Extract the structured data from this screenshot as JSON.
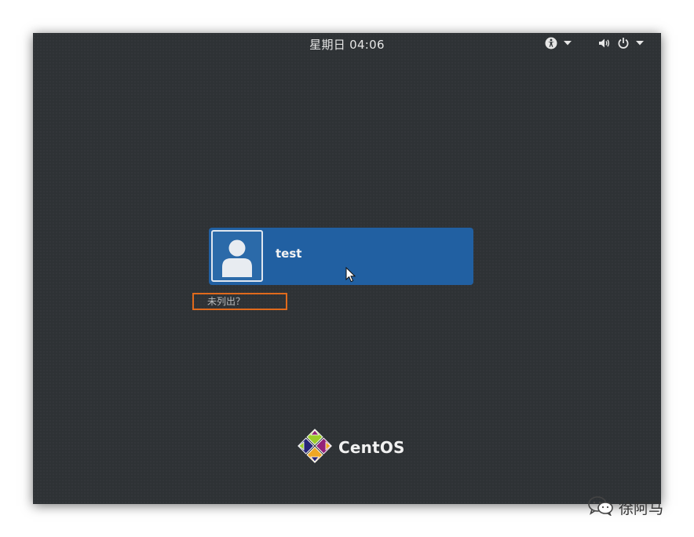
{
  "topbar": {
    "clock": "星期日 04:06",
    "icons": [
      "accessibility-icon",
      "chevron-down-icon",
      "volume-icon",
      "power-icon",
      "chevron-down-icon"
    ]
  },
  "users": [
    {
      "name": "test",
      "avatar_icon": "user-avatar-icon"
    }
  ],
  "not_listed_label": "未列出？",
  "brand": {
    "name": "CentOS",
    "logo_icon": "centos-logo-icon"
  },
  "watermark": {
    "text": "徐阿马",
    "icon": "wechat-icon"
  },
  "colors": {
    "background": "#2e3235",
    "user_card": "#2160a2",
    "highlight_border": "#e06a1c"
  }
}
